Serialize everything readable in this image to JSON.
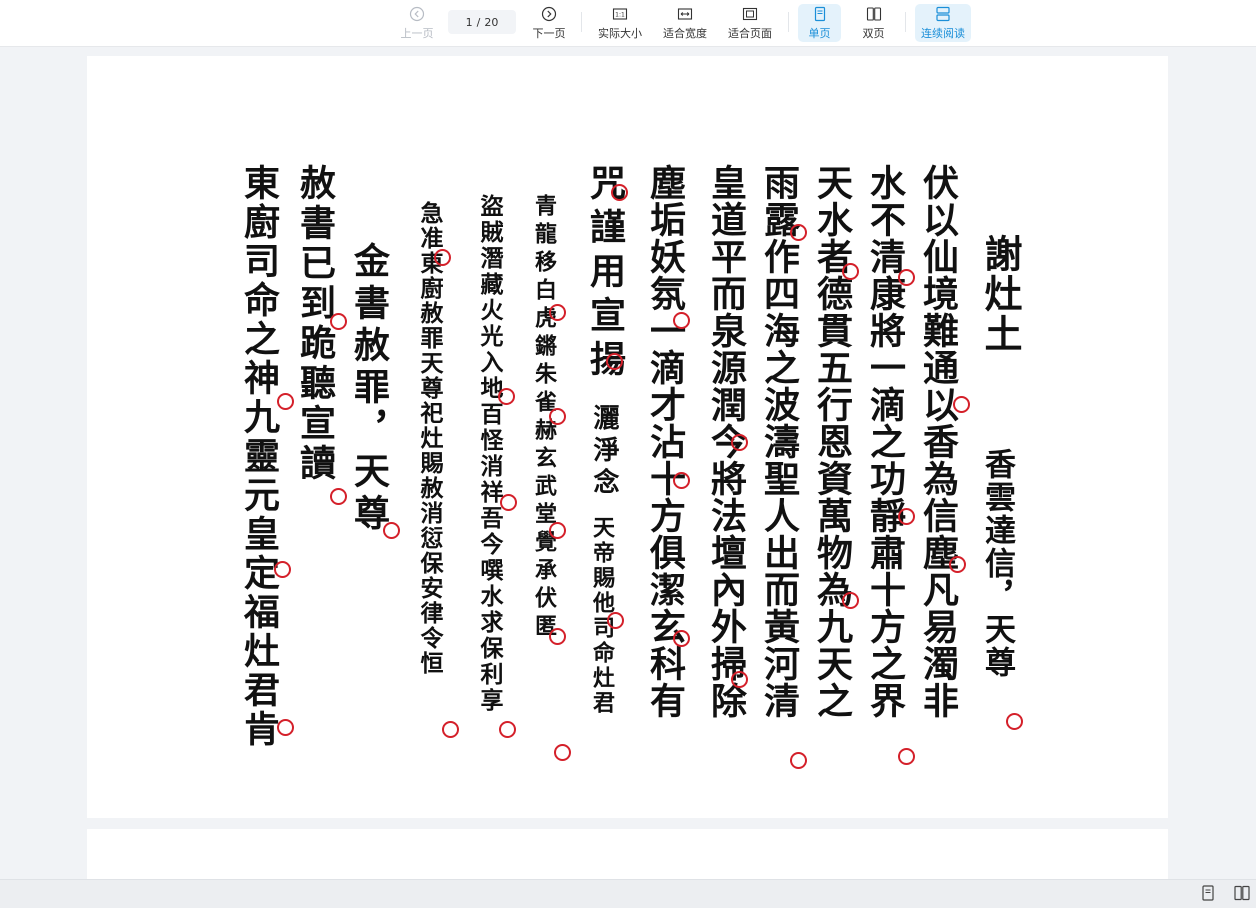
{
  "toolbar": {
    "prev_label": "上一页",
    "current_page": "1",
    "page_separator": "/",
    "total_pages": "20",
    "next_label": "下一页",
    "actual_size_label": "实际大小",
    "fit_width_label": "适合宽度",
    "fit_page_label": "适合页面",
    "single_page_label": "单页",
    "double_page_label": "双页",
    "continuous_label": "连续阅读",
    "accent_color": "#1b8fd8"
  },
  "manuscript": {
    "columns": [
      {
        "id": "c1",
        "text": "謝灶土"
      },
      {
        "id": "c2",
        "text": "香雲達信，天尊"
      },
      {
        "id": "c3",
        "text": "伏以仙境難通以香為信塵凡易濁非"
      },
      {
        "id": "c4",
        "text": "水不清康將一滴之功靜肅十方之界"
      },
      {
        "id": "c5",
        "text": "天水者德貫五行恩資萬物為九天之"
      },
      {
        "id": "c6",
        "text": "雨露作四海之波濤聖人出而黃河清"
      },
      {
        "id": "c7",
        "text": "皇道平而泉源潤今將法壇內外掃除"
      },
      {
        "id": "c8",
        "text": "塵垢妖氛一滴才沾十方俱潔玄科有"
      },
      {
        "id": "c9",
        "text": "咒謹用宣揚"
      },
      {
        "id": "c10",
        "text": "灑淨念"
      },
      {
        "id": "c11",
        "text": "天帝賜他司命灶君"
      },
      {
        "id": "c12",
        "text": "青龍移白虎鏘朱雀赫玄武堂覺承伏匿"
      },
      {
        "id": "c13",
        "text": "盜賊潛藏火光入地百怪消祥吾今噀水求保利享"
      },
      {
        "id": "c14",
        "text": "急准東廚赦罪天尊祀灶賜赦消愆保安律令恒"
      },
      {
        "id": "c15",
        "text": "金書赦罪，天尊"
      },
      {
        "id": "c16",
        "text": "赦書已到跪聽宣讀"
      },
      {
        "id": "c17",
        "text": "東廚司命之神九靈元皇定福灶君肯"
      }
    ]
  },
  "statusbar": {
    "single_icon": "single-page-icon",
    "double_icon": "double-page-icon"
  }
}
